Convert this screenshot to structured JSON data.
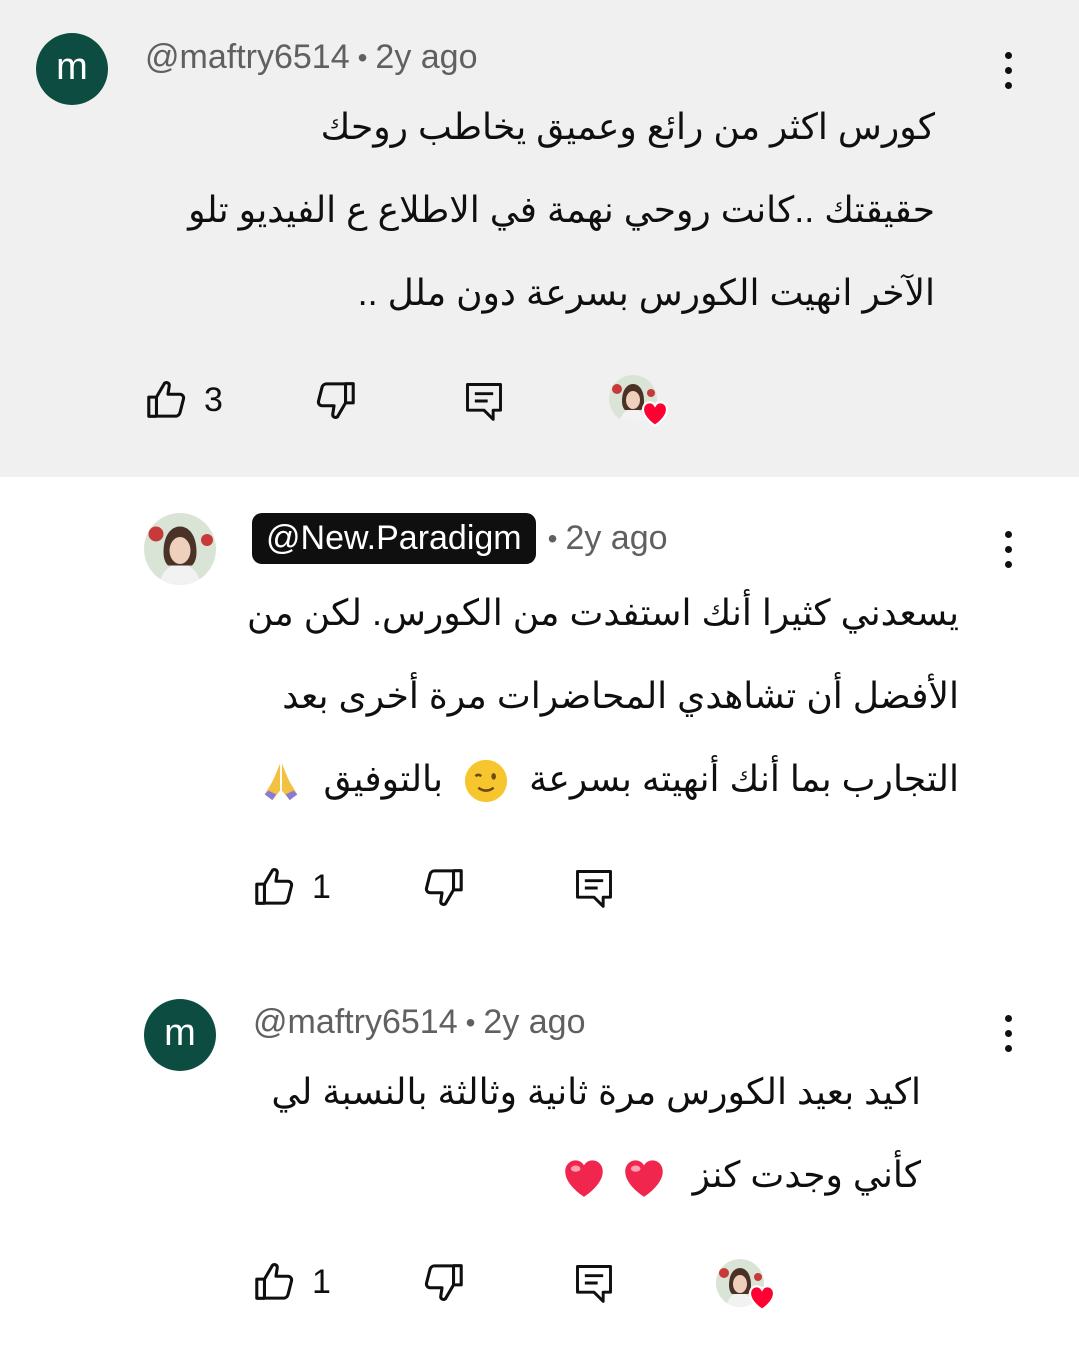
{
  "comments": [
    {
      "author": "@maftry6514",
      "avatar_letter": "m",
      "time": "2y ago",
      "lines": [
        "كورس اكثر من رائع وعميق يخاطب روحك",
        "حقيقتك  ..كانت روحي نهمة في الاطلاع ع الفيديو تلو",
        "الآخر انهيت الكورس بسرعة دون ملل .."
      ],
      "likes": "3",
      "hearted_by_creator": true
    },
    {
      "author": "@New.Paradigm",
      "is_creator": true,
      "time": "2y ago",
      "lines": [
        "يسعدني كثيرا أنك استفدت من الكورس. لكن من",
        "الأفضل أن تشاهدي المحاضرات مرة أخرى بعد",
        "التجارب بما أنك أنهيته بسرعة",
        "بالتوفيق"
      ],
      "likes": "1",
      "hearted_by_creator": false
    },
    {
      "author": "@maftry6514",
      "avatar_letter": "m",
      "time": "2y ago",
      "lines": [
        "اكيد بعيد الكورس مرة ثانية وثالثة بالنسبة لي",
        "كأني وجدت كنز"
      ],
      "likes": "1",
      "hearted_by_creator": true
    }
  ],
  "icons": {
    "like": "thumbs-up-icon",
    "dislike": "thumbs-down-icon",
    "reply": "reply-icon",
    "more": "more-vert-icon",
    "heart": "heart-icon"
  },
  "colors": {
    "highlight_bg": "#f0f0f0",
    "avatar_bg": "#0d4d41",
    "heart": "#ff0033",
    "meta_text": "#606060"
  }
}
